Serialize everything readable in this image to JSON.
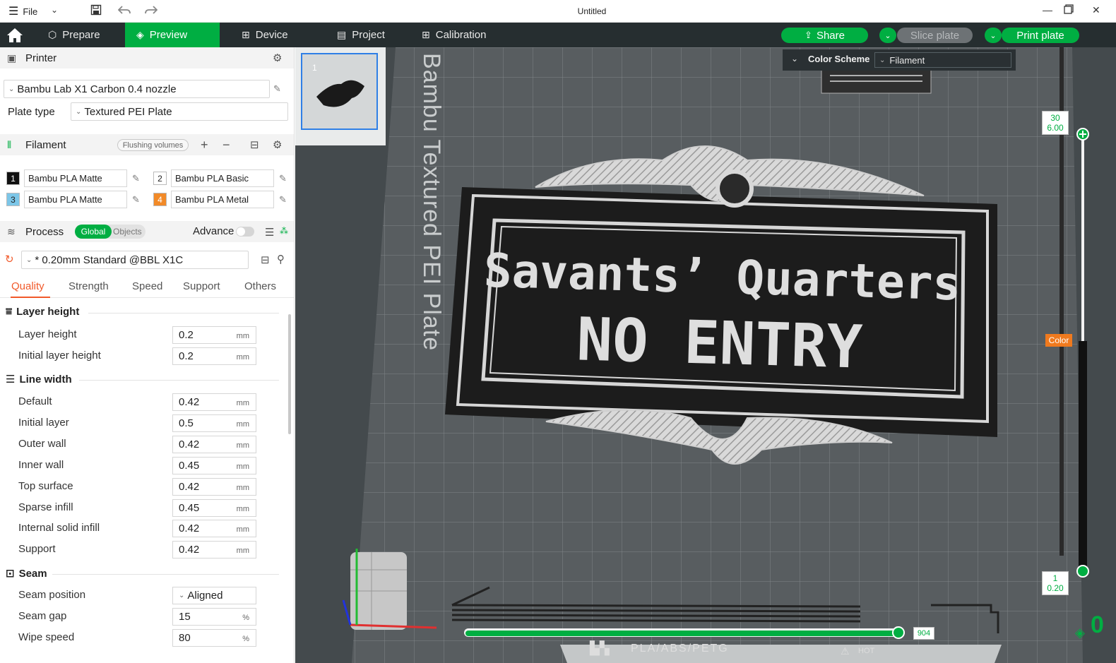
{
  "window": {
    "title": "Untitled",
    "menu_label": "File"
  },
  "nav": {
    "tabs": [
      {
        "label": "Prepare"
      },
      {
        "label": "Preview"
      },
      {
        "label": "Device"
      },
      {
        "label": "Project"
      },
      {
        "label": "Calibration"
      }
    ],
    "share_label": "Share",
    "slice_label": "Slice plate",
    "print_label": "Print plate"
  },
  "printer": {
    "title": "Printer",
    "name": "Bambu Lab X1 Carbon 0.4 nozzle",
    "plate_type_label": "Plate type",
    "plate_type": "Textured PEI Plate"
  },
  "filament": {
    "title": "Filament",
    "flushing_label": "Flushing volumes",
    "items": [
      {
        "index": "1",
        "name": "Bambu PLA Matte",
        "color": "#111111",
        "text_color": "#ffffff"
      },
      {
        "index": "2",
        "name": "Bambu PLA Basic",
        "color": "#ffffff",
        "text_color": "#222222"
      },
      {
        "index": "3",
        "name": "Bambu PLA Matte",
        "color": "#7cc6e8",
        "text_color": "#222222"
      },
      {
        "index": "4",
        "name": "Bambu PLA Metal",
        "color": "#f28a28",
        "text_color": "#ffffff"
      }
    ]
  },
  "process": {
    "title": "Process",
    "global_label": "Global",
    "objects_label": "Objects",
    "advance_label": "Advance",
    "preset": "* 0.20mm Standard @BBL X1C",
    "tabs": [
      "Quality",
      "Strength",
      "Speed",
      "Support",
      "Others"
    ],
    "groups": {
      "layer_height": {
        "title": "Layer height",
        "rows": [
          {
            "label": "Layer height",
            "value": "0.2",
            "unit": "mm"
          },
          {
            "label": "Initial layer height",
            "value": "0.2",
            "unit": "mm"
          }
        ]
      },
      "line_width": {
        "title": "Line width",
        "rows": [
          {
            "label": "Default",
            "value": "0.42",
            "unit": "mm"
          },
          {
            "label": "Initial layer",
            "value": "0.5",
            "unit": "mm"
          },
          {
            "label": "Outer wall",
            "value": "0.42",
            "unit": "mm"
          },
          {
            "label": "Inner wall",
            "value": "0.45",
            "unit": "mm"
          },
          {
            "label": "Top surface",
            "value": "0.42",
            "unit": "mm"
          },
          {
            "label": "Sparse infill",
            "value": "0.45",
            "unit": "mm"
          },
          {
            "label": "Internal solid infill",
            "value": "0.42",
            "unit": "mm"
          },
          {
            "label": "Support",
            "value": "0.42",
            "unit": "mm"
          }
        ]
      },
      "seam": {
        "title": "Seam",
        "rows": [
          {
            "label": "Seam position",
            "value": "Aligned",
            "unit": ""
          },
          {
            "label": "Seam gap",
            "value": "15",
            "unit": "%"
          },
          {
            "label": "Wipe speed",
            "value": "80",
            "unit": "%"
          }
        ]
      }
    }
  },
  "plate": {
    "thumb_number": "1",
    "bed_label": "Bambu Textured PEI Plate",
    "model_text_line1": "Savants’ Quarters",
    "model_text_line2": "NO ENTRY",
    "bottom_label": "PLA/ABS/PETG",
    "hot_label": "HOT"
  },
  "preview": {
    "color_scheme_label": "Color Scheme",
    "color_scheme_value": "Filament",
    "top_layer": "30",
    "top_height": "6.00",
    "bottom_layer": "1",
    "bottom_height": "0.20",
    "color_tag": "Color",
    "moves": "904",
    "layer_zero": "0"
  },
  "colors": {
    "accent": "#00ae42",
    "active_tab": "#f1592a",
    "navbar": "#262e30"
  }
}
